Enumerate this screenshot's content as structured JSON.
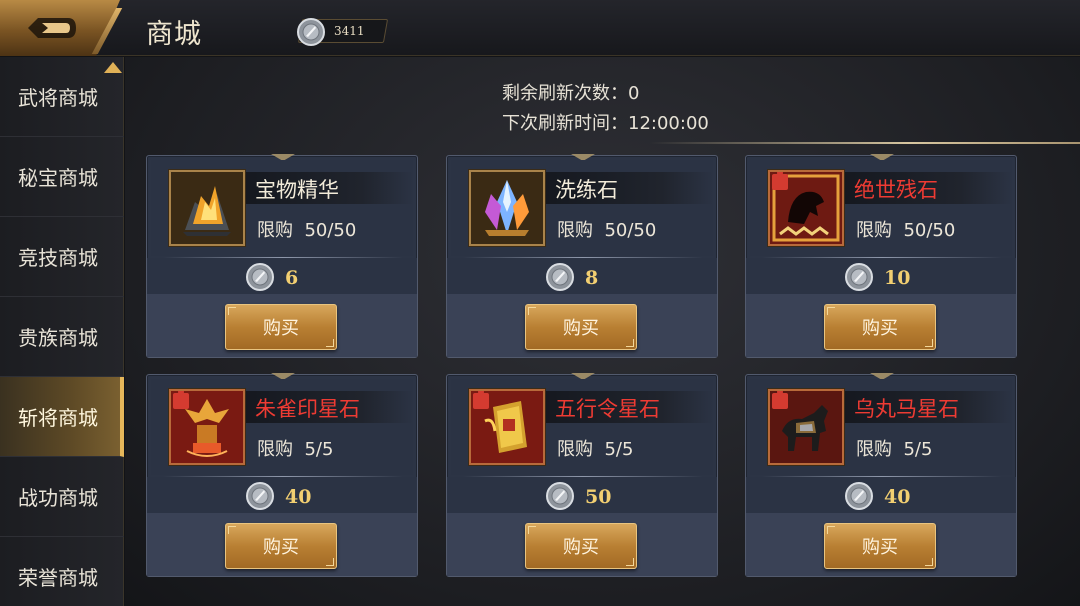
{
  "header": {
    "title": "商城",
    "currency_value": "3411"
  },
  "sidebar": {
    "items": [
      {
        "label": "武将商城",
        "active": false
      },
      {
        "label": "秘宝商城",
        "active": false
      },
      {
        "label": "竞技商城",
        "active": false
      },
      {
        "label": "贵族商城",
        "active": false
      },
      {
        "label": "斩将商城",
        "active": true
      },
      {
        "label": "战功商城",
        "active": false
      },
      {
        "label": "荣誉商城",
        "active": false
      }
    ]
  },
  "refresh": {
    "remaining_label": "剩余刷新次数：",
    "remaining_value": "0",
    "next_label": "下次刷新时间：",
    "next_value": "12:00:00"
  },
  "items": [
    {
      "name": "宝物精华",
      "limit_label": "限购",
      "limit": "50/50",
      "price": "6",
      "buy_label": "购买",
      "name_color": "#f3ecda",
      "icon": "treasure-essence-icon"
    },
    {
      "name": "洗练石",
      "limit_label": "限购",
      "limit": "50/50",
      "price": "8",
      "buy_label": "购买",
      "name_color": "#f3ecda",
      "icon": "refining-crystal-icon"
    },
    {
      "name": "绝世残石",
      "limit_label": "限购",
      "limit": "50/50",
      "price": "10",
      "buy_label": "购买",
      "name_color": "#ee3b33",
      "icon": "peerless-shard-icon"
    },
    {
      "name": "朱雀印星石",
      "limit_label": "限购",
      "limit": "5/5",
      "price": "40",
      "buy_label": "购买",
      "name_color": "#ee3b33",
      "icon": "vermilion-seal-icon"
    },
    {
      "name": "五行令星石",
      "limit_label": "限购",
      "limit": "5/5",
      "price": "50",
      "buy_label": "购买",
      "name_color": "#ee3b33",
      "icon": "five-elements-token-icon"
    },
    {
      "name": "乌丸马星石",
      "limit_label": "限购",
      "limit": "5/5",
      "price": "40",
      "buy_label": "购买",
      "name_color": "#ee3b33",
      "icon": "wuhuan-horse-icon"
    }
  ]
}
